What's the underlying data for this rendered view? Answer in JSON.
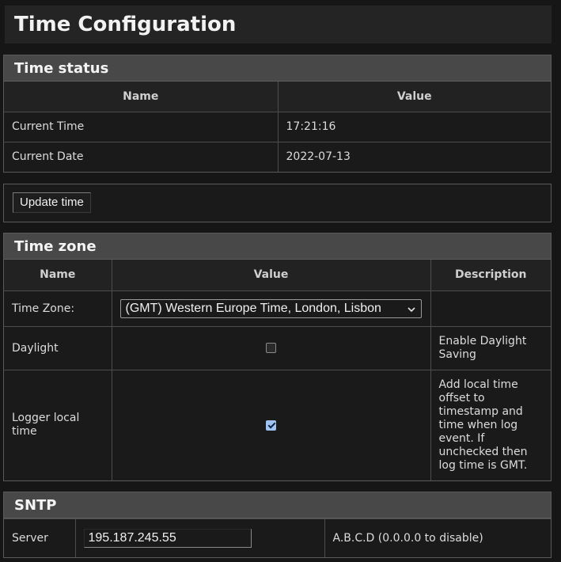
{
  "page_title": "Time Configuration",
  "time_status": {
    "header": "Time status",
    "columns": [
      "Name",
      "Value"
    ],
    "rows": [
      {
        "name": "Current Time",
        "value": "17:21:16"
      },
      {
        "name": "Current Date",
        "value": "2022-07-13"
      }
    ]
  },
  "update_button": "Update time",
  "time_zone": {
    "header": "Time zone",
    "columns": [
      "Name",
      "Value",
      "Description"
    ],
    "timezone": {
      "label": "Time Zone:",
      "selected": "(GMT) Western Europe Time, London, Lisbon"
    },
    "daylight": {
      "label": "Daylight",
      "checked": false,
      "description": "Enable Daylight Saving"
    },
    "logger": {
      "label": "Logger local time",
      "checked": true,
      "description": "Add local time offset to timestamp and time when log event. If unchecked then log time is GMT."
    }
  },
  "sntp": {
    "header": "SNTP",
    "server": {
      "label": "Server",
      "value": "195.187.245.55",
      "description": "A.B.C.D (0.0.0.0 to disable)"
    }
  },
  "icons": {
    "select_chevron": "chevron-down-icon",
    "check": "checkmark-icon"
  }
}
